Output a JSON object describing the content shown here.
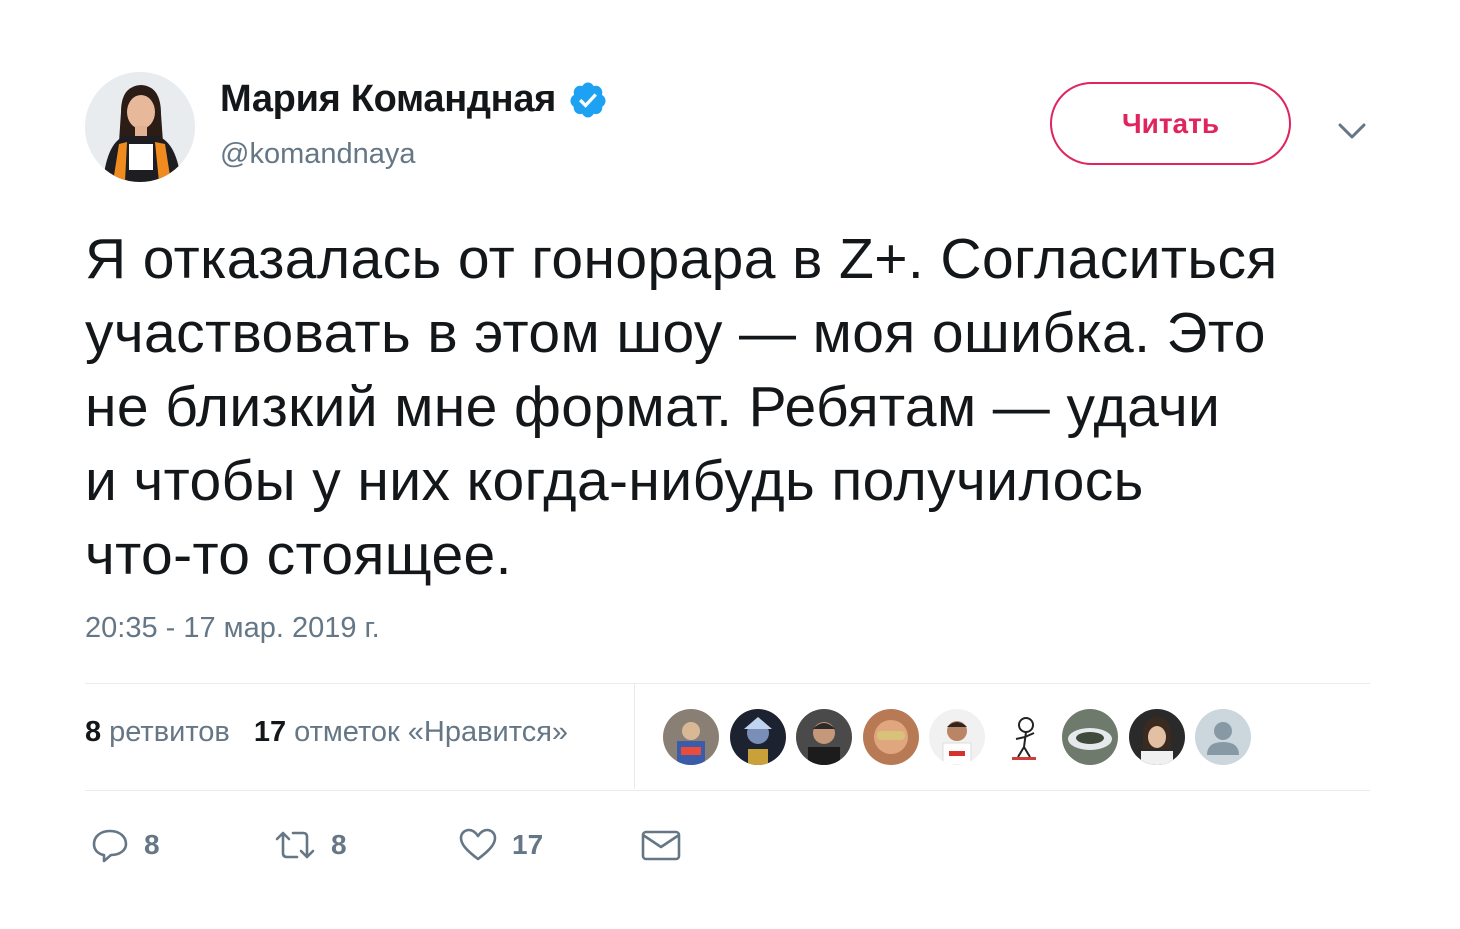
{
  "user": {
    "display_name": "Мария Командная",
    "handle": "@komandnaya",
    "verified": true,
    "avatar_icon": "profile-photo"
  },
  "follow_button": {
    "label": "Читать"
  },
  "more_icon": "chevron-down-icon",
  "tweet": {
    "lines": [
      "Я отказалась от гонорара в Z+. Согласиться",
      "участвовать в этом шоу — моя ошибка. Это",
      "не близкий мне формат. Ребятам — удачи",
      "и чтобы у них когда-нибудь получилось",
      "что-то стоящее."
    ],
    "timestamp": "20:35 - 17 мар. 2019 г."
  },
  "stats": {
    "retweets_count": "8",
    "retweets_label": "ретвитов",
    "likes_count": "17",
    "likes_label": "отметок «Нравится»"
  },
  "liker_avatars": [
    "avatar-1",
    "avatar-2",
    "avatar-3",
    "avatar-4",
    "avatar-5",
    "avatar-6",
    "avatar-7",
    "avatar-8",
    "avatar-default"
  ],
  "actions": {
    "reply_count": "8",
    "retweet_count": "8",
    "like_count": "17"
  },
  "colors": {
    "accent_pink": "#e0245e",
    "verified_blue": "#1da1f2",
    "secondary_text": "#657786",
    "primary_text": "#14171a",
    "divider": "#e6ecf0"
  }
}
